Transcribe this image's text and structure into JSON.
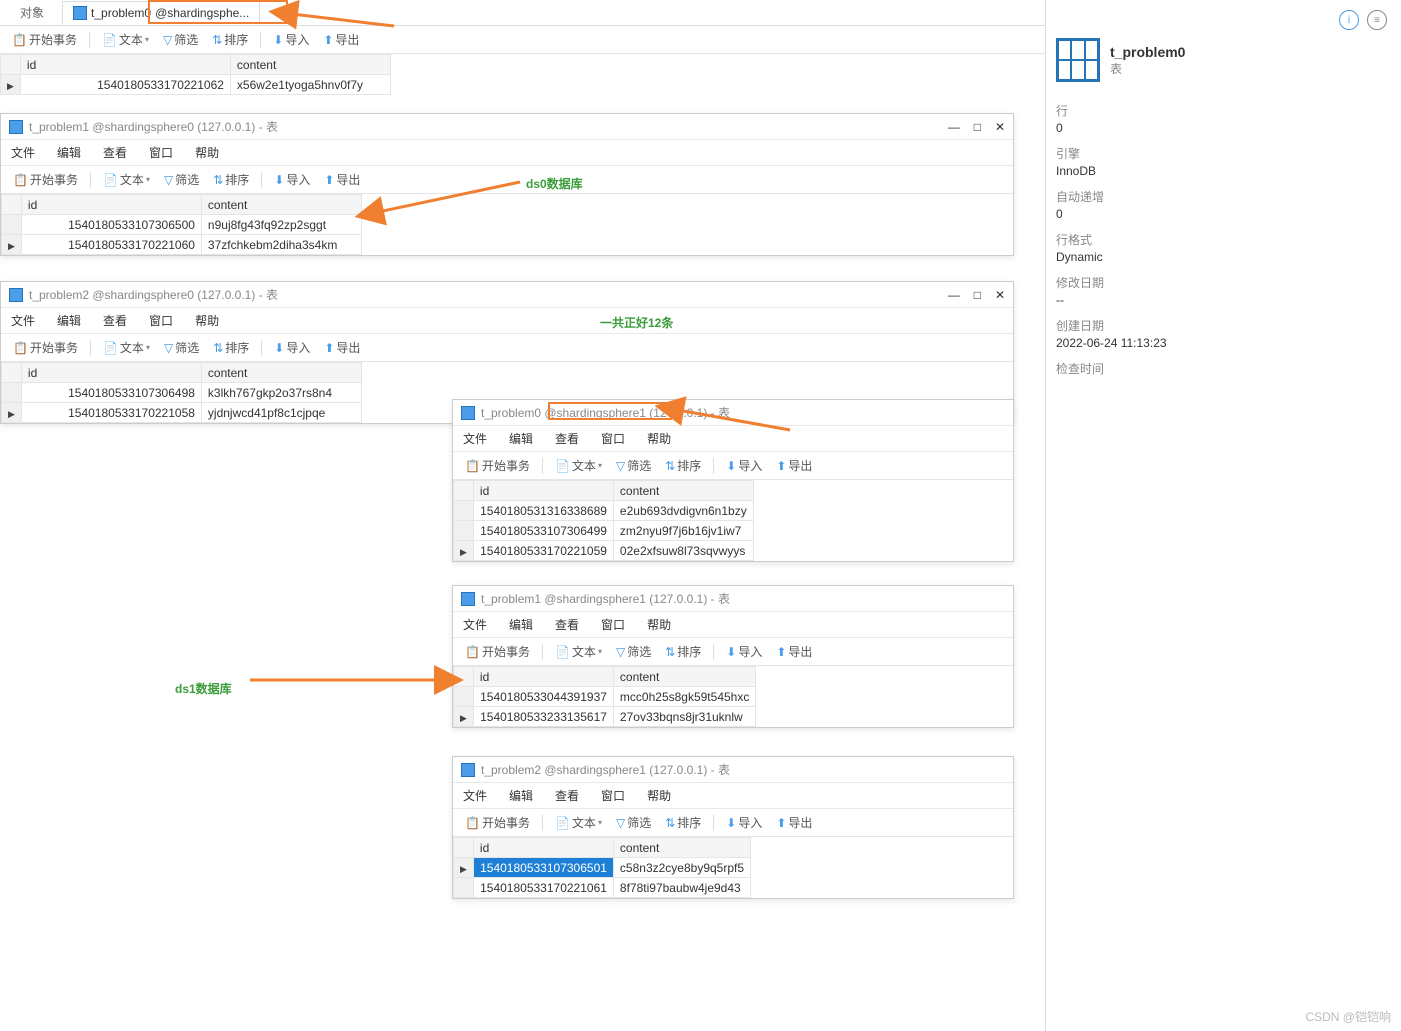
{
  "tabs": {
    "objects": "对象",
    "active": "t_problem0",
    "active_suffix": "@shardingsphe..."
  },
  "toolbar": {
    "begin": "开始事务",
    "text": "文本",
    "filter": "筛选",
    "sort": "排序",
    "import": "导入",
    "export": "导出"
  },
  "menubar": {
    "file": "文件",
    "edit": "编辑",
    "view": "查看",
    "window": "窗口",
    "help": "帮助"
  },
  "cols": {
    "id": "id",
    "content": "content"
  },
  "suffix": "表",
  "main": {
    "rows": [
      {
        "id": "1540180533170221062",
        "content": "x56w2e1tyoga5hnv0f7y"
      }
    ]
  },
  "win1": {
    "title": "t_problem1 @shardingsphere0 (127.0.0.1) - 表",
    "rows": [
      {
        "id": "1540180533107306500",
        "content": "n9uj8fg43fq92zp2sggt"
      },
      {
        "id": "1540180533170221060",
        "content": "37zfchkebm2diha3s4km"
      }
    ]
  },
  "win2": {
    "title": "t_problem2 @shardingsphere0 (127.0.0.1) - 表",
    "rows": [
      {
        "id": "1540180533107306498",
        "content": "k3lkh767gkp2o37rs8n4"
      },
      {
        "id": "1540180533170221058",
        "content": "yjdnjwcd41pf8c1cjpqe"
      }
    ]
  },
  "win3": {
    "title": "t_problem0 @shardingsphere1 (127.0.0.1) - 表",
    "rows": [
      {
        "id": "1540180531316338689",
        "content": "e2ub693dvdigvn6n1bzy"
      },
      {
        "id": "1540180533107306499",
        "content": "zm2nyu9f7j6b16jv1iw7"
      },
      {
        "id": "1540180533170221059",
        "content": "02e2xfsuw8l73sqvwyys"
      }
    ]
  },
  "win4": {
    "title": "t_problem1 @shardingsphere1 (127.0.0.1) - 表",
    "rows": [
      {
        "id": "1540180533044391937",
        "content": "mcc0h25s8gk59t545hxc"
      },
      {
        "id": "1540180533233135617",
        "content": "27ov33bqns8jr31uknlw"
      }
    ]
  },
  "win5": {
    "title": "t_problem2 @shardingsphere1 (127.0.0.1) - 表",
    "rows": [
      {
        "id": "1540180533107306501",
        "content": "c58n3z2cye8by9q5rpf5",
        "sel": true
      },
      {
        "id": "1540180533170221061",
        "content": "8f78ti97baubw4je9d43"
      }
    ]
  },
  "annot": {
    "ds0": "ds0数据库",
    "ds1": "ds1数据库",
    "total": "一共正好12条"
  },
  "side": {
    "title": "t_problem0",
    "subtitle": "表",
    "rows_lbl": "行",
    "rows_val": "0",
    "engine_lbl": "引擎",
    "engine_val": "InnoDB",
    "ai_lbl": "自动递增",
    "ai_val": "0",
    "fmt_lbl": "行格式",
    "fmt_val": "Dynamic",
    "mod_lbl": "修改日期",
    "mod_val": "--",
    "crt_lbl": "创建日期",
    "crt_val": "2022-06-24 11:13:23",
    "chk_lbl": "检查时间"
  },
  "watermark": "CSDN @铠铠响"
}
